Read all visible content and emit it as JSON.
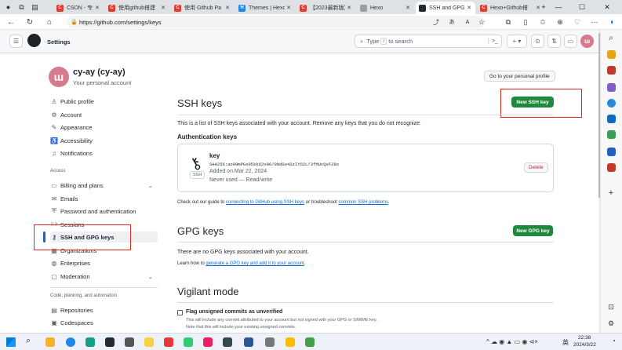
{
  "browser": {
    "tabs": [
      {
        "label": "CSDN - 专业开发",
        "color": "#e23b2e",
        "glyph": "C"
      },
      {
        "label": "使用github搭建",
        "color": "#e23b2e",
        "glyph": "C"
      },
      {
        "label": "使用 Github Pa",
        "color": "#e23b2e",
        "glyph": "C"
      },
      {
        "label": "Themes | Hexo",
        "color": "#1e88e5",
        "glyph": "H"
      },
      {
        "label": "【2023最新版】",
        "color": "#e23b2e",
        "glyph": "C"
      },
      {
        "label": "Hexo",
        "color": "#9e9e9e",
        "glyph": ""
      },
      {
        "label": "SSH and GPG k",
        "color": "#24292f",
        "glyph": ""
      },
      {
        "label": "Hexo+Github搭",
        "color": "#e23b2e",
        "glyph": "C"
      }
    ],
    "url": "https://github.com/settings/keys",
    "controls": {
      "minimize": "—",
      "maximize": "☐",
      "close": "✕",
      "new_tab": "+"
    }
  },
  "header": {
    "title": "Settings",
    "search_prefix": "Type",
    "search_key": "/",
    "search_suffix": "to search"
  },
  "profile": {
    "name": "cy-ay (cy-ay)",
    "subtitle": "Your personal account",
    "go_profile": "Go to your personal profile"
  },
  "sidebar": {
    "items": [
      {
        "label": "Public profile",
        "icon": "person-icon"
      },
      {
        "label": "Account",
        "icon": "gear-icon"
      },
      {
        "label": "Appearance",
        "icon": "paintbrush-icon"
      },
      {
        "label": "Accessibility",
        "icon": "accessibility-icon"
      },
      {
        "label": "Notifications",
        "icon": "bell-icon"
      }
    ],
    "access_heading": "Access",
    "access_items": [
      {
        "label": "Billing and plans",
        "icon": "credit-card-icon",
        "chevron": "⌄"
      },
      {
        "label": "Emails",
        "icon": "mail-icon"
      },
      {
        "label": "Password and authentication",
        "icon": "shield-lock-icon"
      },
      {
        "label": "Sessions",
        "icon": "broadcast-icon"
      },
      {
        "label": "SSH and GPG keys",
        "icon": "key-icon"
      },
      {
        "label": "Organizations",
        "icon": "organization-icon"
      },
      {
        "label": "Enterprises",
        "icon": "globe-icon"
      },
      {
        "label": "Moderation",
        "icon": "comment-icon",
        "chevron": "⌄"
      }
    ],
    "code_heading": "Code, planning, and automation",
    "code_items": [
      {
        "label": "Repositories",
        "icon": "repo-icon"
      },
      {
        "label": "Codespaces",
        "icon": "codespaces-icon"
      }
    ]
  },
  "ssh": {
    "title": "SSH keys",
    "new_button": "New SSH key",
    "description": "This is a list of SSH keys associated with your account. Remove any keys that you do not recognize.",
    "auth_heading": "Authentication keys",
    "key": {
      "name": "key",
      "fingerprint": "SHA256:ao99mPGx95kk62v96/0NdGo4SzIYO2L/3fMUcQvF29o",
      "added": "Added on Mar 22, 2024",
      "used": "Never used — Read/write",
      "badge": "SSH",
      "delete": "Delete"
    },
    "guide_prefix": "Check out our guide to",
    "guide_link1": "connecting to GitHub using SSH keys",
    "guide_mid": "or troubleshoot",
    "guide_link2": "common SSH problems",
    "guide_end": "."
  },
  "gpg": {
    "title": "GPG keys",
    "new_button": "New GPG key",
    "empty": "There are no GPG keys associated with your account.",
    "learn_prefix": "Learn how to",
    "learn_link": "generate a GPG key and add it to your account",
    "learn_end": "."
  },
  "vigilant": {
    "title": "Vigilant mode",
    "checkbox_label": "Flag unsigned commits as unverified",
    "note1": "This will include any commit attributed to your account but not signed with your GPG or S/MIME key.",
    "note2": "Note that this will include your existing unsigned commits."
  },
  "taskbar": {
    "time": "22:38",
    "date": "2024/3/22",
    "lang": "英"
  }
}
